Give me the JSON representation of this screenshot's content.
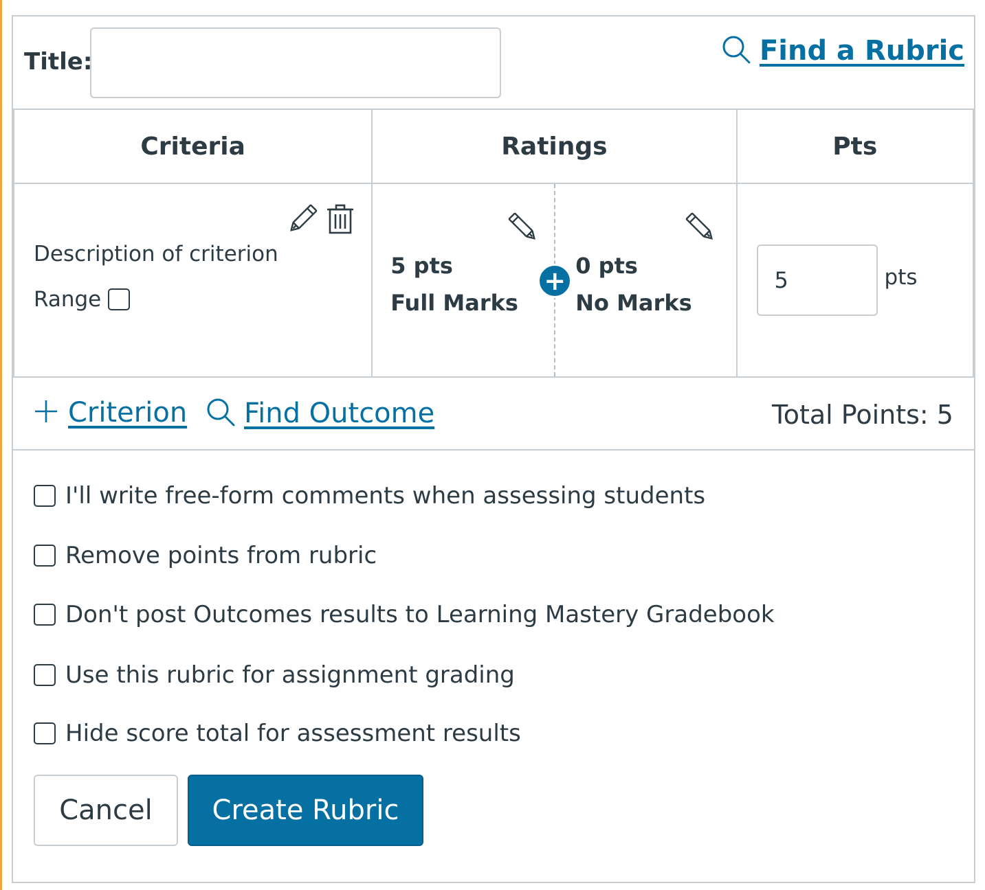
{
  "header": {
    "title_label": "Title:",
    "title_value": "",
    "find_rubric_label": "Find a Rubric"
  },
  "table": {
    "columns": [
      "Criteria",
      "Ratings",
      "Pts"
    ],
    "criterion": {
      "description": "Description of criterion",
      "range_label": "Range",
      "ratings": [
        {
          "points": "5 pts",
          "label": "Full Marks"
        },
        {
          "points": "0 pts",
          "label": "No Marks"
        }
      ],
      "points_value": "5",
      "points_unit": "pts"
    }
  },
  "actions": {
    "add_criterion_label": "Criterion",
    "find_outcome_label": "Find Outcome",
    "total_points": "Total Points: 5"
  },
  "options": [
    "I'll write free-form comments when assessing students",
    "Remove points from rubric",
    "Don't post Outcomes results to Learning Mastery Gradebook",
    "Use this rubric for assignment grading",
    "Hide score total for assessment results"
  ],
  "buttons": {
    "cancel": "Cancel",
    "create": "Create Rubric"
  },
  "colors": {
    "accent": "#0770a3",
    "text": "#2d3b45",
    "border": "#c7cdd1"
  }
}
